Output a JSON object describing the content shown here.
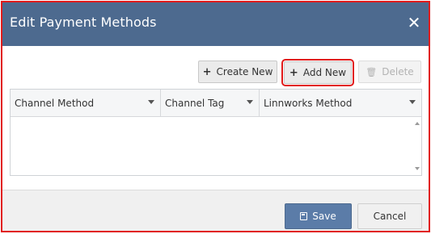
{
  "dialog": {
    "title": "Edit Payment Methods",
    "close_glyph": "✕",
    "border_color": "#e11b1b",
    "header_color": "#4d6a8f"
  },
  "toolbar": {
    "create_new": {
      "label": "Create New",
      "icon": "plus-icon",
      "glyph": "+"
    },
    "add_new": {
      "label": "Add New",
      "icon": "plus-icon",
      "glyph": "+",
      "highlighted": true
    },
    "delete": {
      "label": "Delete",
      "icon": "trash-icon",
      "glyph": "🗑",
      "disabled": true
    }
  },
  "grid": {
    "columns": [
      {
        "label": "Channel Method"
      },
      {
        "label": "Channel Tag"
      },
      {
        "label": "Linnworks Method"
      }
    ],
    "rows": []
  },
  "footer": {
    "save": {
      "label": "Save",
      "icon": "save-icon"
    },
    "cancel": {
      "label": "Cancel"
    }
  }
}
